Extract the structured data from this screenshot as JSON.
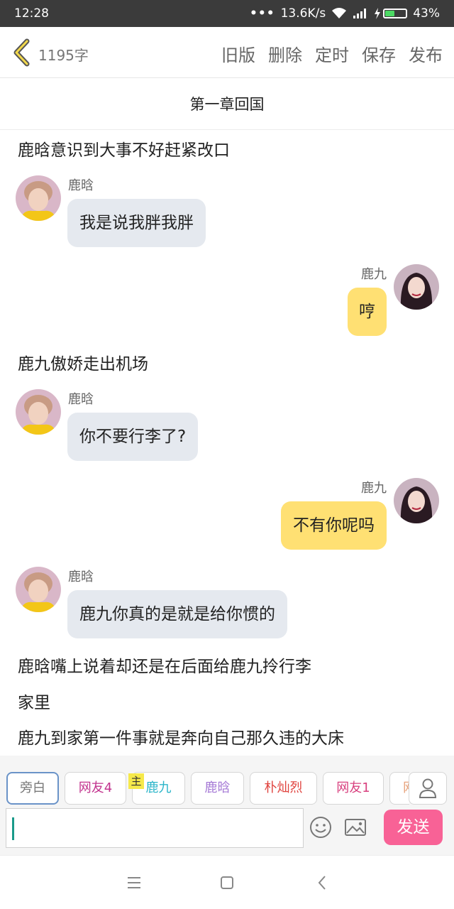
{
  "status_bar": {
    "time": "12:28",
    "dots": "•••",
    "network_speed": "13.6K/s",
    "battery_percent": "43%",
    "battery_level": 0.43,
    "battery_color": "#4cd964"
  },
  "toolbar": {
    "back_icon": "chevron-left-icon",
    "word_count": "1195字",
    "actions": [
      "旧版",
      "删除",
      "定时",
      "保存",
      "发布"
    ]
  },
  "chapter_title": "第一章回国",
  "messages": [
    {
      "type": "narration",
      "text": "鹿晗意识到大事不好赶紧改口"
    },
    {
      "type": "left",
      "name": "鹿晗",
      "text": "我是说我胖我胖"
    },
    {
      "type": "right",
      "name": "鹿九",
      "text": "哼"
    },
    {
      "type": "narration",
      "text": "鹿九傲娇走出机场"
    },
    {
      "type": "left",
      "name": "鹿晗",
      "text": "你不要行李了?"
    },
    {
      "type": "right",
      "name": "鹿九",
      "text": "不有你呢吗"
    },
    {
      "type": "left",
      "name": "鹿晗",
      "text": "鹿九你真的是就是给你惯的"
    },
    {
      "type": "narration",
      "text": "鹿晗嘴上说着却还是在后面给鹿九拎行李"
    },
    {
      "type": "narration",
      "text": "家里"
    },
    {
      "type": "narration",
      "text": "鹿九到家第一件事就是奔向自己那久违的大床"
    }
  ],
  "roles": [
    {
      "label": "旁白",
      "color": "#777777"
    },
    {
      "label": "网友4",
      "color": "#c2338e"
    },
    {
      "label": "鹿九",
      "color": "#2bb5c9"
    },
    {
      "label": "鹿晗",
      "color": "#a67ad6"
    },
    {
      "label": "朴灿烈",
      "color": "#e0443f"
    },
    {
      "label": "网友1",
      "color": "#d8417f"
    },
    {
      "label": "网",
      "color": "#e8a37c"
    }
  ],
  "host_tag": "主",
  "input": {
    "placeholder": "",
    "value": ""
  },
  "send_label": "发送",
  "colors": {
    "left_bubble": "#e5e9ef",
    "right_bubble": "#ffe073",
    "send_button": "#f86296"
  }
}
